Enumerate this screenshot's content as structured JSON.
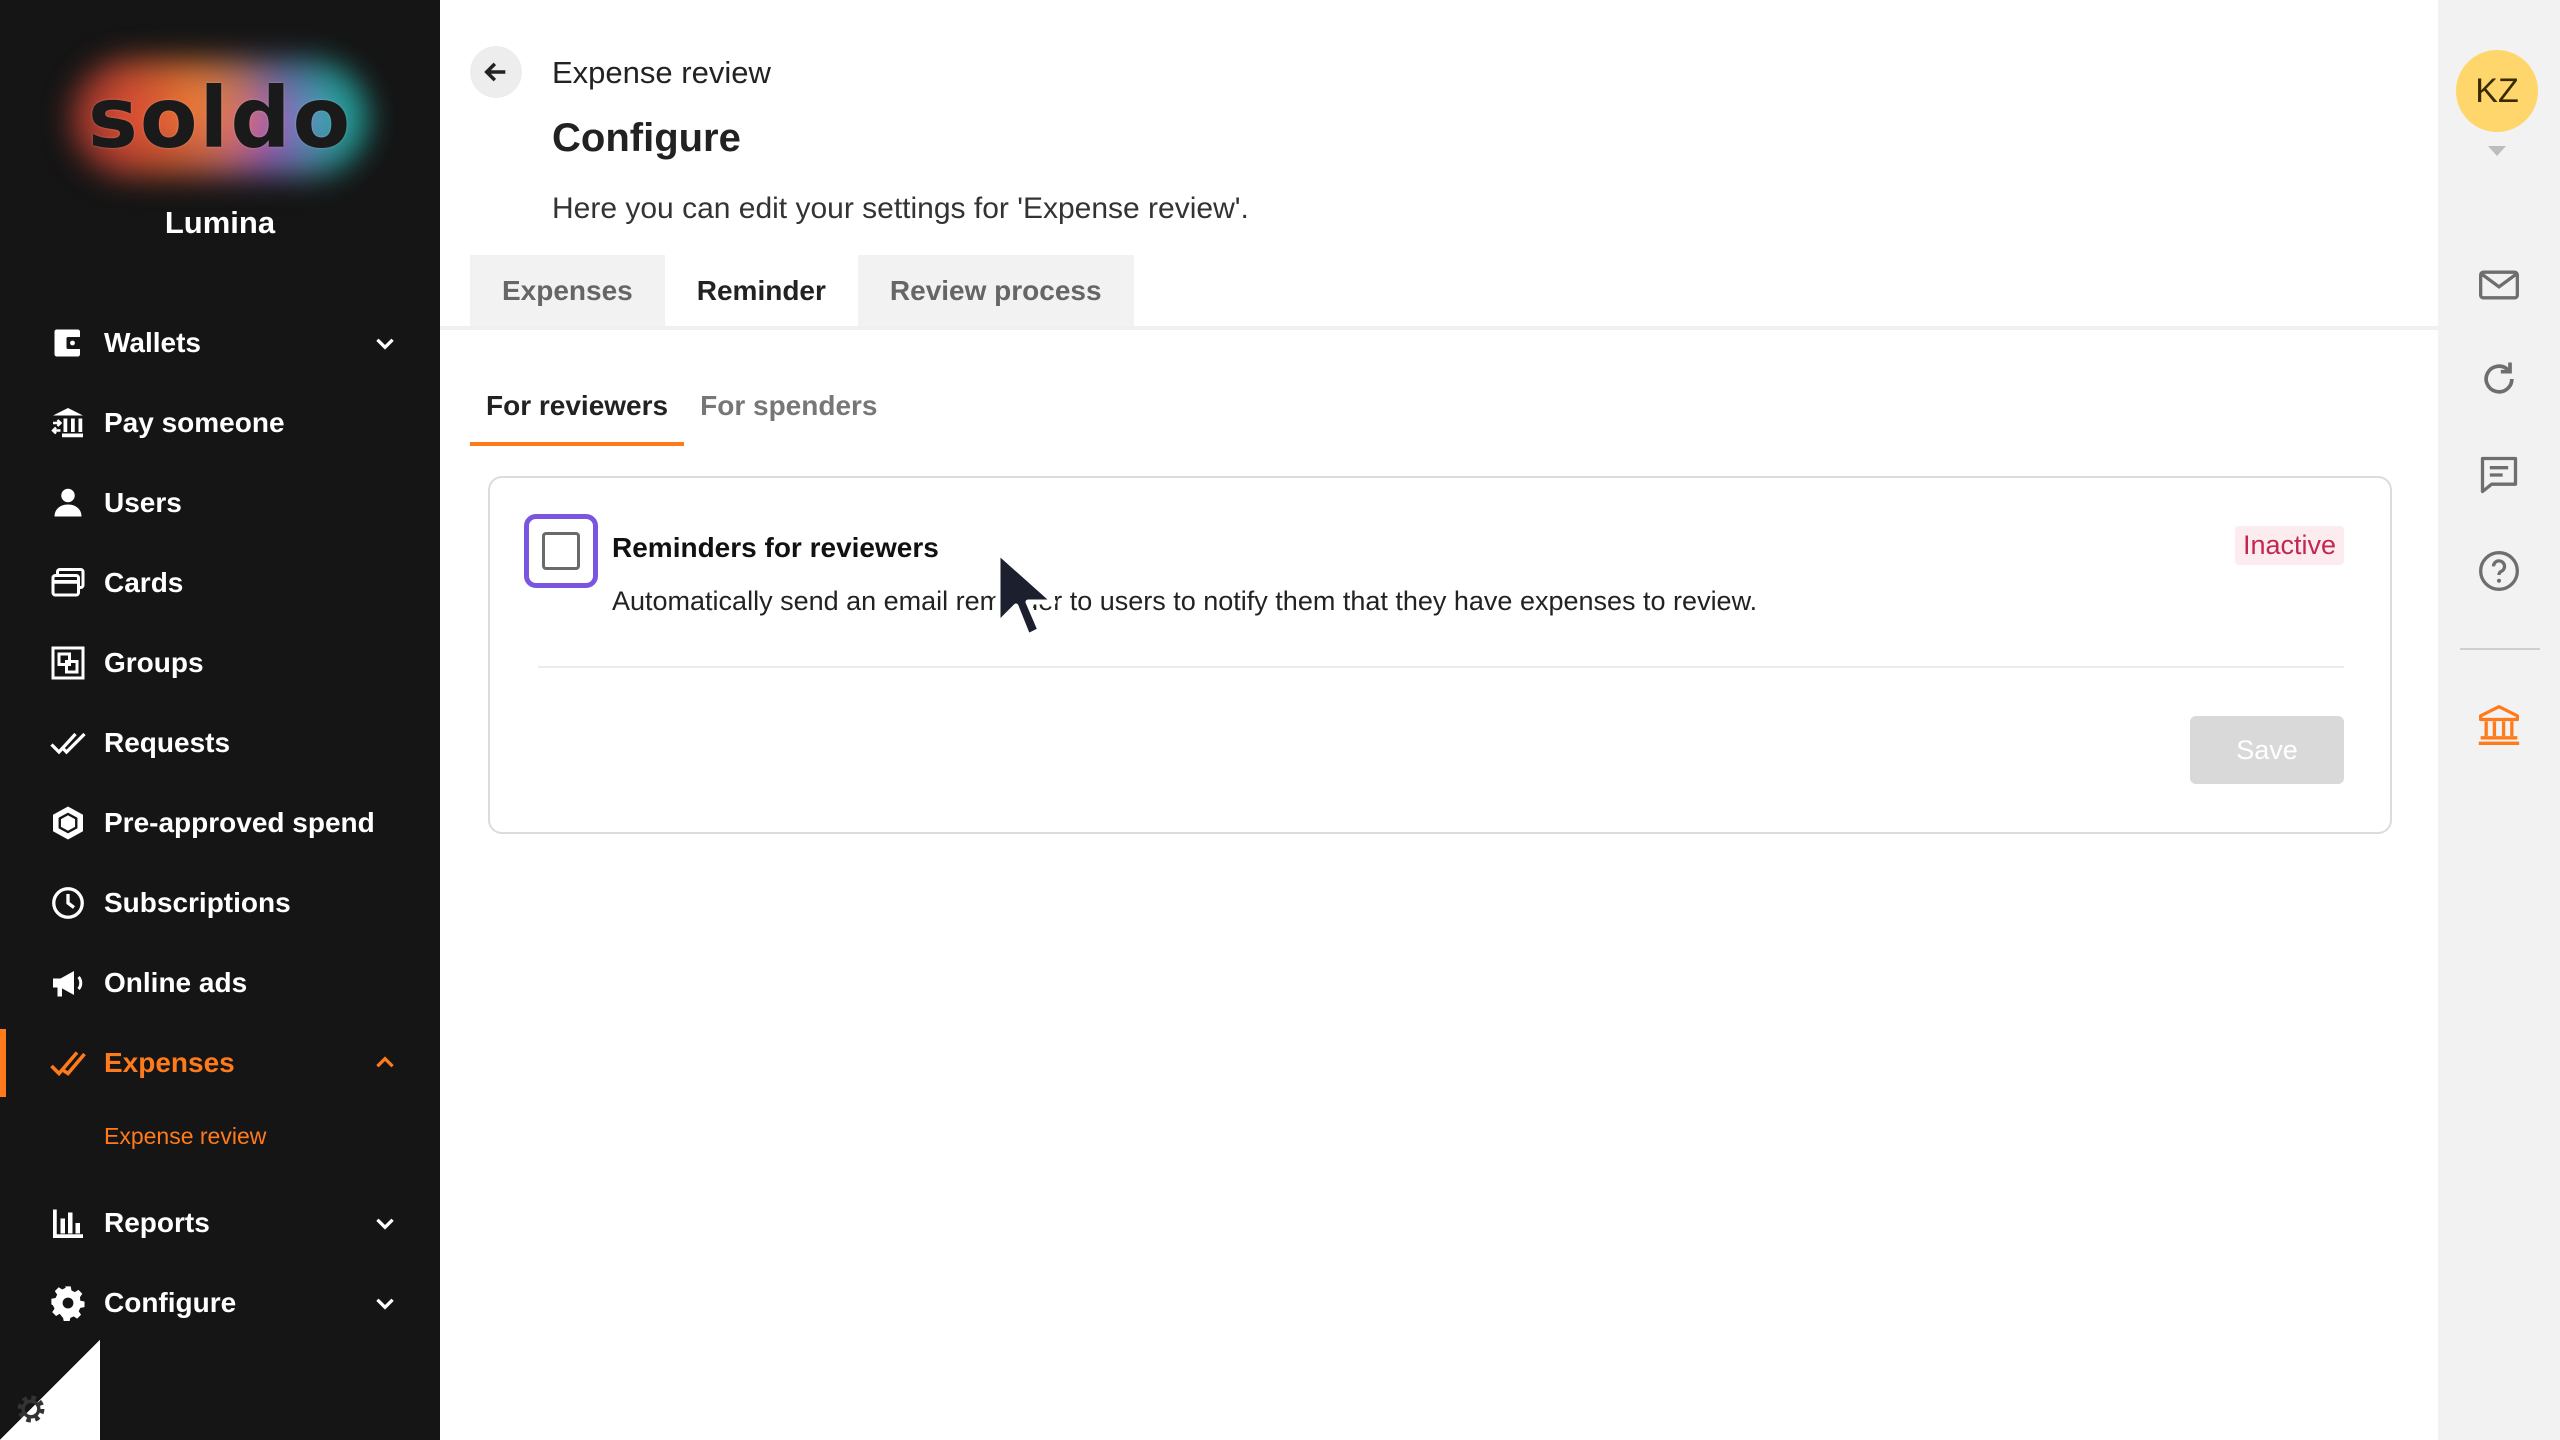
{
  "sidebar": {
    "logo_text": "soldo",
    "company": "Lumina",
    "items": [
      {
        "label": "Wallets"
      },
      {
        "label": "Pay someone"
      },
      {
        "label": "Users"
      },
      {
        "label": "Cards"
      },
      {
        "label": "Groups"
      },
      {
        "label": "Requests"
      },
      {
        "label": "Pre-approved spend"
      },
      {
        "label": "Subscriptions"
      },
      {
        "label": "Online ads"
      },
      {
        "label": "Expenses"
      },
      {
        "label": "Reports"
      },
      {
        "label": "Configure"
      }
    ],
    "sub_item": "Expense review"
  },
  "header": {
    "breadcrumb": "Expense review",
    "title": "Configure",
    "description": "Here you can edit your settings for 'Expense review'."
  },
  "tabs": [
    {
      "label": "Expenses"
    },
    {
      "label": "Reminder"
    },
    {
      "label": "Review process"
    }
  ],
  "subtabs": [
    {
      "label": "For reviewers"
    },
    {
      "label": "For spenders"
    }
  ],
  "card": {
    "title": "Reminders for reviewers",
    "text": "Automatically send an email reminder to users to notify them that they have expenses to review.",
    "status": "Inactive",
    "save_label": "Save"
  },
  "rail": {
    "avatar_initials": "KZ"
  },
  "colors": {
    "sidebar_bg": "#151515",
    "accent": "#ff7a1a",
    "focus": "#7a55e0",
    "inactive": "#c3264f"
  }
}
